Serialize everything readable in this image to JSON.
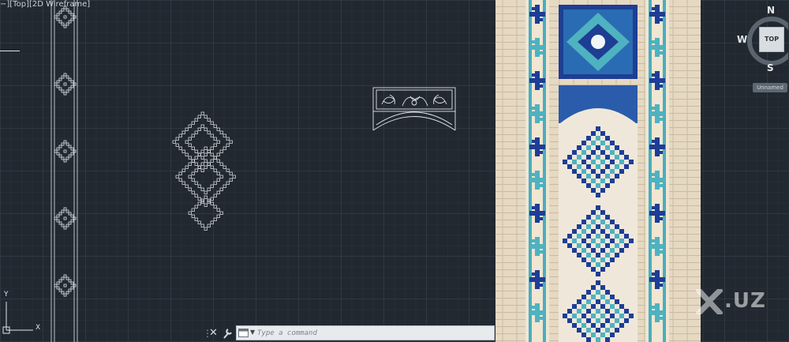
{
  "viewport": {
    "label": "−][Top][2D Wireframe]"
  },
  "ucs": {
    "x_label": "X",
    "y_label": "Y"
  },
  "command_line": {
    "placeholder": "Type a command"
  },
  "viewcube": {
    "north": "N",
    "south": "S",
    "west": "W",
    "face": "TOP",
    "ucs_menu": "Unnamed"
  },
  "watermark": {
    "text": ".UZ"
  },
  "colors": {
    "canvas_background": "#212830",
    "linework": "#e6e9ee",
    "tile_dark_blue": "#1d3d96",
    "tile_turquoise": "#4fb2c0",
    "tile_cream": "#efe5d0"
  }
}
